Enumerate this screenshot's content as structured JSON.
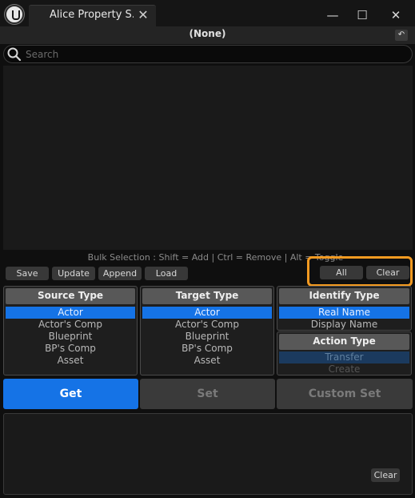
{
  "window": {
    "tab_title": "Alice Property S...",
    "tab_close": "✕",
    "minimize": "—",
    "maximize": "☐",
    "close": "✕"
  },
  "header": {
    "title": "(None)",
    "undo": "↶"
  },
  "search": {
    "placeholder": "Search",
    "value": ""
  },
  "hint": "Bulk Selection : Shift = Add | Ctrl = Remove | Alt = Toggle",
  "toolbar": {
    "save": "Save",
    "update": "Update",
    "append": "Append",
    "load": "Load",
    "all": "All",
    "clear": "Clear"
  },
  "source_type": {
    "title": "Source Type",
    "options": [
      "Actor",
      "Actor's Comp",
      "Blueprint",
      "BP's Comp",
      "Asset"
    ],
    "selected": "Actor"
  },
  "target_type": {
    "title": "Target Type",
    "options": [
      "Actor",
      "Actor's Comp",
      "Blueprint",
      "BP's Comp",
      "Asset"
    ],
    "selected": "Actor"
  },
  "identify_type": {
    "title": "Identify Type",
    "options": [
      "Real Name",
      "Display Name"
    ],
    "selected": "Real Name"
  },
  "action_type": {
    "title": "Action Type",
    "options": [
      "Transfer",
      "Create"
    ],
    "selected": "Transfer"
  },
  "actions": {
    "get": "Get",
    "set": "Set",
    "custom_set": "Custom Set"
  },
  "log": {
    "clear": "Clear"
  },
  "colors": {
    "accent": "#1573e6",
    "highlight": "#f39a21"
  }
}
